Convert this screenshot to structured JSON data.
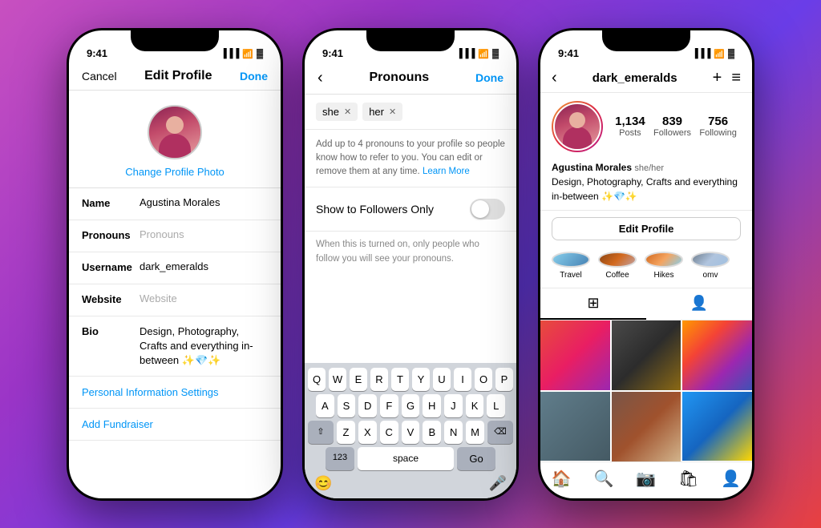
{
  "background": "gradient-purple-pink-red",
  "phone1": {
    "status_time": "9:41",
    "nav": {
      "cancel": "Cancel",
      "title": "Edit Profile",
      "done": "Done"
    },
    "profile_photo": {
      "change_text": "Change Profile Photo"
    },
    "form": [
      {
        "label": "Name",
        "value": "Agustina Morales",
        "placeholder": false
      },
      {
        "label": "Pronouns",
        "value": "Pronouns",
        "placeholder": true
      },
      {
        "label": "Username",
        "value": "dark_emeralds",
        "placeholder": false
      },
      {
        "label": "Website",
        "value": "Website",
        "placeholder": true
      },
      {
        "label": "Bio",
        "value": "Design, Photography, Crafts and everything in-between ✨💎✨",
        "placeholder": false,
        "multiline": true
      }
    ],
    "links": [
      "Personal Information Settings",
      "Add Fundraiser"
    ]
  },
  "phone2": {
    "status_time": "9:41",
    "nav": {
      "title": "Pronouns",
      "done": "Done"
    },
    "tags": [
      "she",
      "her"
    ],
    "description": "Add up to 4 pronouns to your profile so people know how to refer to you. You can edit or remove them at any time.",
    "learn_more": "Learn More",
    "toggle_label": "Show to Followers Only",
    "toggle_desc": "When this is turned on, only people who follow you will see your pronouns.",
    "keyboard": {
      "rows": [
        [
          "Q",
          "W",
          "E",
          "R",
          "T",
          "Y",
          "U",
          "I",
          "O",
          "P"
        ],
        [
          "A",
          "S",
          "D",
          "F",
          "G",
          "H",
          "J",
          "K",
          "L"
        ],
        [
          "⇧",
          "Z",
          "X",
          "C",
          "V",
          "B",
          "N",
          "M",
          "⌫"
        ],
        [
          "123",
          "space",
          "Go"
        ]
      ]
    }
  },
  "phone3": {
    "status_time": "9:41",
    "nav": {
      "username": "dark_emeralds",
      "plus": "+",
      "menu": "≡"
    },
    "stats": {
      "posts": {
        "count": "1,134",
        "label": "Posts"
      },
      "followers": {
        "count": "839",
        "label": "Followers"
      },
      "following": {
        "count": "756",
        "label": "Following"
      }
    },
    "bio": {
      "name": "Agustina Morales",
      "pronouns": "she/her",
      "text": "Design, Photography, Crafts and everything in-between ✨💎✨"
    },
    "edit_button": "Edit Profile",
    "highlights": [
      {
        "label": "Travel",
        "class": "hl-travel"
      },
      {
        "label": "Coffee",
        "class": "hl-coffee"
      },
      {
        "label": "Hikes",
        "class": "hl-hikes"
      },
      {
        "label": "omv",
        "class": "hl-omv"
      }
    ],
    "bottom_nav": [
      "🏠",
      "🔍",
      "📷",
      "🛍",
      "👤"
    ]
  }
}
